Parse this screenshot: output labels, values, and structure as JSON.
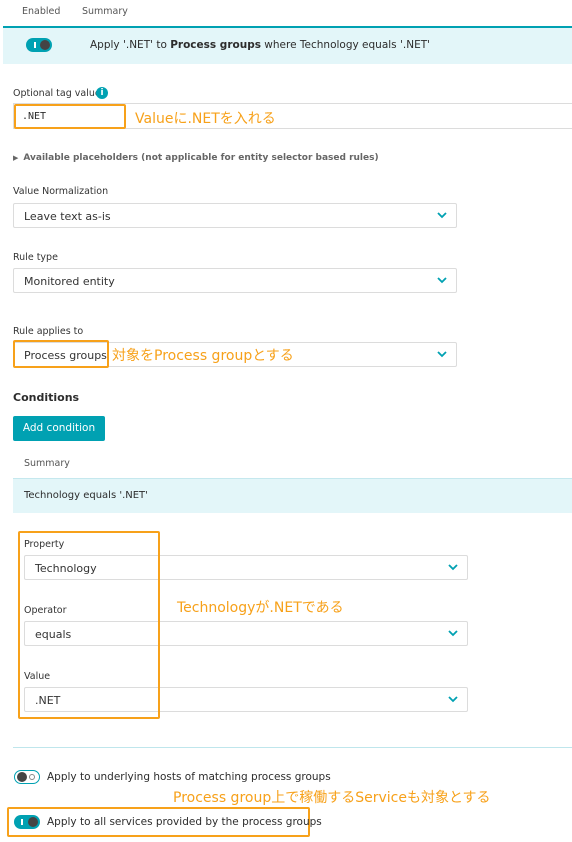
{
  "table_header": {
    "enabled": "Enabled",
    "summary": "Summary"
  },
  "rule_summary": {
    "prefix": "Apply '.NET' to ",
    "bold": "Process groups",
    "suffix": " where Technology equals '.NET'",
    "enabled": true
  },
  "tag_value": {
    "label": "Optional tag value",
    "value": ".NET",
    "info_icon": "info-icon"
  },
  "placeholders": {
    "label": "Available placeholders (not applicable for entity selector based rules)"
  },
  "value_normalization": {
    "label": "Value Normalization",
    "selected": "Leave text as-is"
  },
  "rule_type": {
    "label": "Rule type",
    "selected": "Monitored entity"
  },
  "rule_applies_to": {
    "label": "Rule applies to",
    "selected": "Process groups"
  },
  "conditions": {
    "heading": "Conditions",
    "add_button": "Add condition",
    "summary_header": "Summary",
    "summary_text": "Technology equals '.NET'",
    "property": {
      "label": "Property",
      "selected": "Technology"
    },
    "operator": {
      "label": "Operator",
      "selected": "equals"
    },
    "value": {
      "label": "Value",
      "selected": ".NET"
    }
  },
  "options": {
    "hosts": {
      "label": "Apply to underlying hosts of matching process groups",
      "enabled": false
    },
    "services": {
      "label": "Apply to all services provided by the process groups",
      "enabled": true
    }
  },
  "annotations": {
    "tag_value": "Valueに.NETを入れる",
    "applies_to": "対象をProcess groupとする",
    "condition": "Technologyが.NETである",
    "services": "Process group上で稼働するServiceも対象とする"
  },
  "colors": {
    "accent": "#00a1b2",
    "annotation": "#f7a11a",
    "summary_bg": "#e3f6f9"
  }
}
